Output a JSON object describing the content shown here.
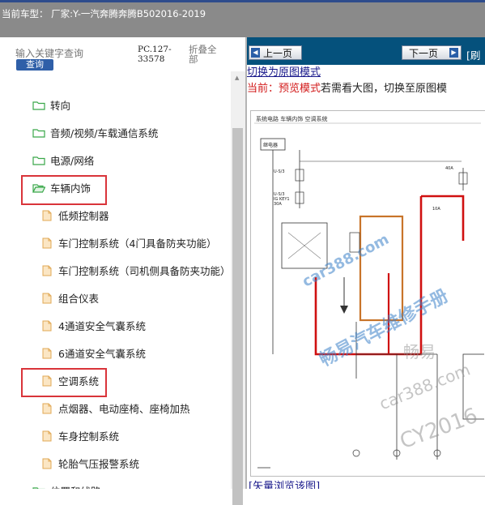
{
  "header": {
    "title": "当前车型： 厂家:Y-一汽奔腾奔腾B502016-2019"
  },
  "toolbar": {
    "search_placeholder": "输入关键字查询",
    "search_button": "查询",
    "pc_code": "PC.127-33578",
    "collapse_all": "折叠全部"
  },
  "tree": {
    "items": [
      {
        "label": "转向",
        "type": "folder"
      },
      {
        "label": "音频/视频/车载通信系统",
        "type": "folder"
      },
      {
        "label": "电源/网络",
        "type": "folder"
      },
      {
        "label": "车辆内饰",
        "type": "folder-open",
        "highlighted": true
      },
      {
        "label": "低频控制器",
        "type": "file"
      },
      {
        "label": "车门控制系统（4门具备防夹功能）",
        "type": "file"
      },
      {
        "label": "车门控制系统（司机侧具备防夹功能）",
        "type": "file"
      },
      {
        "label": "组合仪表",
        "type": "file"
      },
      {
        "label": "4通道安全气囊系统",
        "type": "file"
      },
      {
        "label": "6通道安全气囊系统",
        "type": "file"
      },
      {
        "label": "空调系统",
        "type": "file",
        "highlighted": true
      },
      {
        "label": "点烟器、电动座椅、座椅加热",
        "type": "file"
      },
      {
        "label": "车身控制系统",
        "type": "file"
      },
      {
        "label": "轮胎气压报警系统",
        "type": "file"
      },
      {
        "label": "位置和线路",
        "type": "folder"
      }
    ]
  },
  "viewer": {
    "prev_button": "上一页",
    "next_button": "下一页",
    "refresh": "[刷",
    "switch_link": "切换为原图模式",
    "mode_current": "当前：预览模式",
    "mode_hint": "若需看大图，切换至原图模",
    "diagram_caption": "系统电路  车辆内饰  空调系统",
    "diagram_labels": {
      "fuse_box": "继电器",
      "label_a": "U-S/3",
      "label_b": "U-S/3",
      "label_c": "IG KEY1",
      "label_d": "30A",
      "label_e": "40A",
      "label_f": "10A"
    },
    "vector_link": "[矢量浏览该图]",
    "watermarks": [
      "car388.com",
      "畅易汽车维修手册",
      "畅易",
      "car388.com",
      "CY2016"
    ]
  },
  "colors": {
    "header_bg": "#8a8a8a",
    "nav_bg": "#05517c",
    "highlight_red": "#d9343a",
    "link_blue": "#1a1a8c",
    "search_button_bg": "#2f5fa8"
  }
}
